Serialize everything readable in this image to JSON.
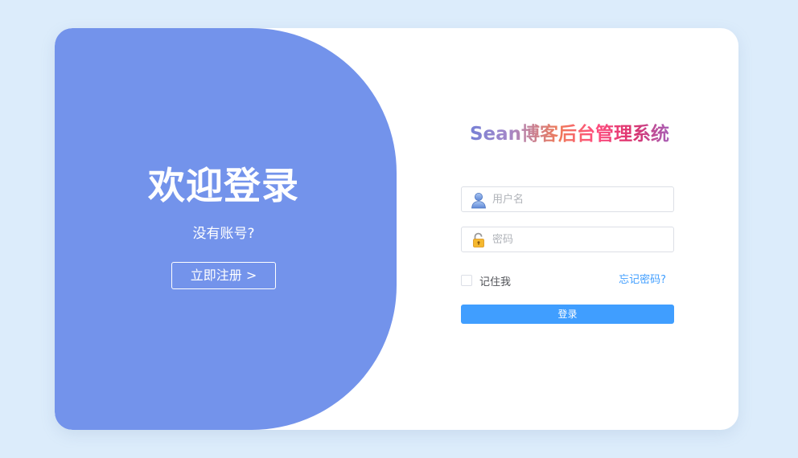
{
  "welcome_panel": {
    "title": "欢迎登录",
    "no_account_text": "没有账号?",
    "register_button_label": "立即注册 >"
  },
  "login_form": {
    "brand_title": "Sean博客后台管理系统",
    "username": {
      "placeholder": "用户名",
      "value": "",
      "icon": "user-icon"
    },
    "password": {
      "placeholder": "密码",
      "value": "",
      "icon": "lock-icon"
    },
    "remember_label": "记住我",
    "remember_checked": false,
    "forgot_password_label": "忘记密码?",
    "login_button_label": "登录"
  },
  "colors": {
    "page_background": "#dcecfb",
    "panel_accent": "#7393eb",
    "primary_button": "#409eff",
    "link": "#409eff"
  }
}
